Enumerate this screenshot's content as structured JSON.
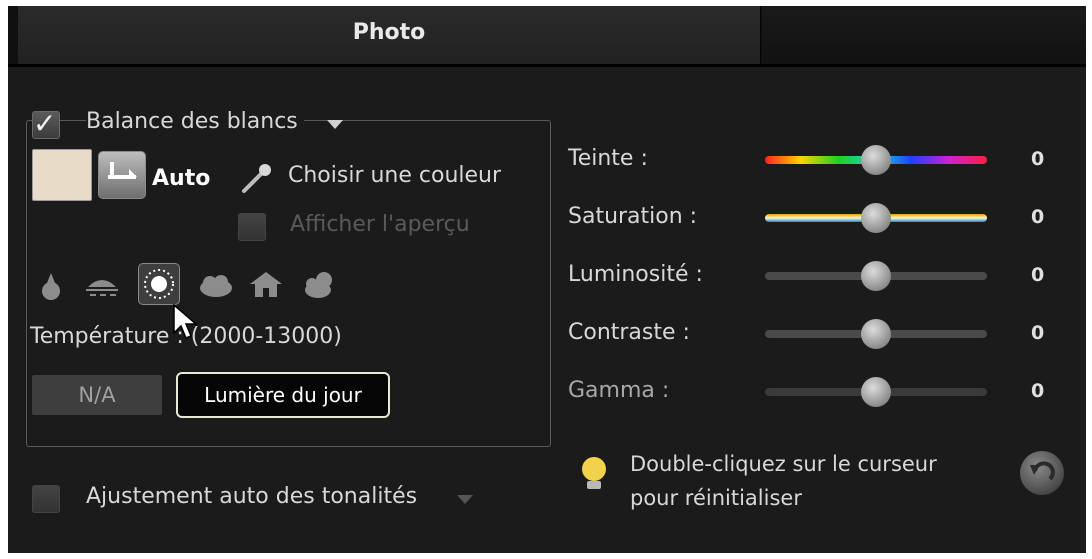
{
  "tabs": [
    {
      "label": "Photo",
      "active": true
    },
    {
      "label": "",
      "active": false
    }
  ],
  "white_balance": {
    "label": "Balance des blancs",
    "enabled": true,
    "swatch_color": "#e8dcc8",
    "auto_label": "Auto",
    "pick_color_label": "Choisir une couleur",
    "preview_label": "Afficher l'aperçu",
    "preview_checked": false,
    "presets": [
      {
        "icon": "candle-icon"
      },
      {
        "icon": "lamp-icon"
      },
      {
        "icon": "sun-icon",
        "selected": true
      },
      {
        "icon": "cloud-icon"
      },
      {
        "icon": "house-shade-icon"
      },
      {
        "icon": "cloud-sun-icon"
      }
    ],
    "temperature_label": "Température : (2000-13000)",
    "temperature_value": "N/A",
    "tooltip": "Lumière du jour"
  },
  "auto_tone": {
    "label": "Ajustement auto des tonalités",
    "checked": false
  },
  "sliders": [
    {
      "label": "Teinte :",
      "value": "0",
      "track": "hue"
    },
    {
      "label": "Saturation :",
      "value": "0",
      "track": "saturation"
    },
    {
      "label": "Luminosité :",
      "value": "0",
      "track": "gray"
    },
    {
      "label": "Contraste :",
      "value": "0",
      "track": "gray"
    },
    {
      "label": "Gamma :",
      "value": "0",
      "track": "gray"
    }
  ],
  "hint": {
    "line1": "Double-cliquez sur le curseur",
    "line2": "pour réinitialiser"
  }
}
